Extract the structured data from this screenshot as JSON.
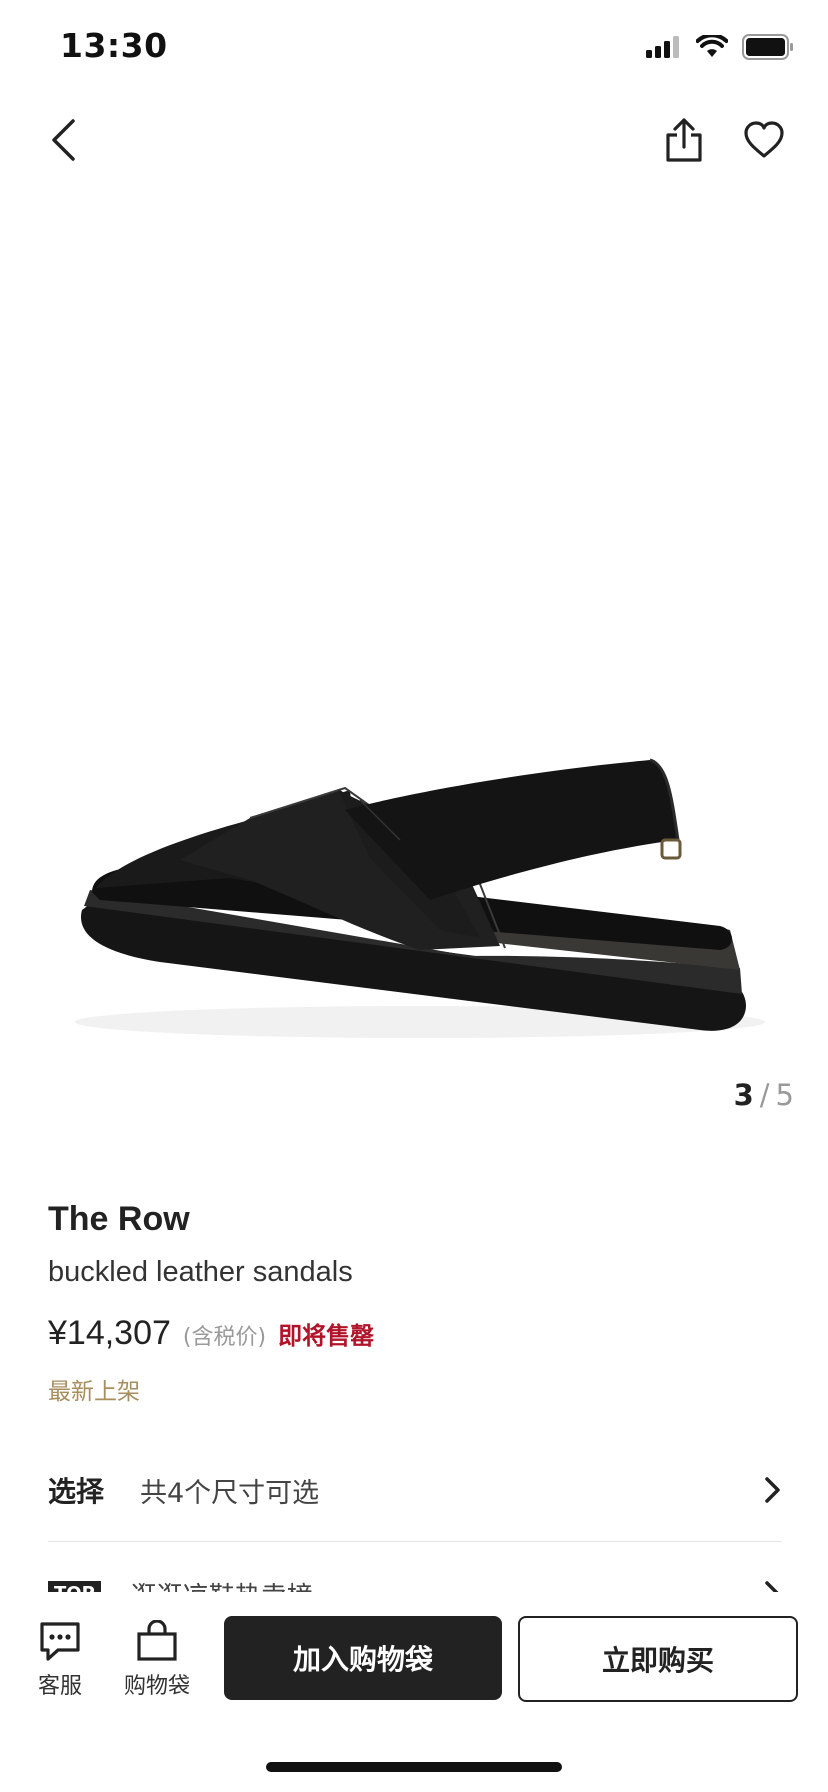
{
  "status_bar": {
    "time": "13:30"
  },
  "gallery": {
    "current": "3",
    "separator": "/",
    "total": "5"
  },
  "product": {
    "brand": "The Row",
    "name": "buckled leather sandals",
    "price": "¥14,307",
    "tax_note": "(含税价)",
    "stock_status": "即将售罄",
    "new_tag": "最新上架"
  },
  "size_select": {
    "label": "选择",
    "value": "共4个尺寸可选"
  },
  "ranking": {
    "badge": "TOP",
    "text": "逛逛凉鞋热卖榜"
  },
  "bottom_bar": {
    "service_label": "客服",
    "bag_label": "购物袋",
    "add_to_bag_label": "加入购物袋",
    "buy_now_label": "立即购买"
  },
  "colors": {
    "accent_red": "#b0142a",
    "tag_gold": "#a88e5e",
    "primary": "#222222"
  },
  "icons": [
    "back-icon",
    "share-icon",
    "heart-icon",
    "chat-icon",
    "bag-icon",
    "chevron-right-icon"
  ]
}
